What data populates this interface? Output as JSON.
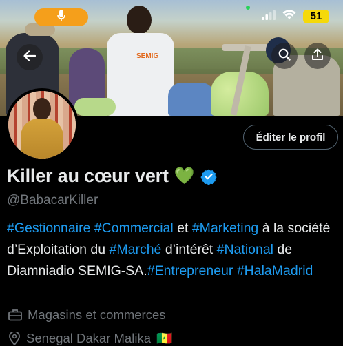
{
  "status_bar": {
    "battery": "51",
    "colors": {
      "pill": "#f59f1b",
      "battery": "#f5d90a"
    },
    "icons": [
      "microphone-icon",
      "signal-icon",
      "wifi-icon",
      "battery-icon"
    ]
  },
  "header": {
    "icons": [
      "back-arrow-icon",
      "search-icon",
      "share-icon"
    ],
    "banner_image_text": "SEMIG"
  },
  "profile": {
    "edit_button": "Éditer le profil",
    "name": "Killer au cœur vert",
    "name_emoji": "💚",
    "verified_icon": "verified-badge-icon",
    "handle": "@BabacarKiller",
    "bio": {
      "t1": "#Gestionnaire",
      "t2": " ",
      "t3": "#Commercial",
      "t4": " et ",
      "t5": "#Marketing",
      "t6": " à la société d’Exploitation du ",
      "t7": "#Marché",
      "t8": " d’intérêt ",
      "t9": "#National",
      "t10": " de Diamniadio SEMIG-SA.",
      "t11": "#Entrepreneur",
      "t12": " ",
      "t13": "#HalaMadrid"
    },
    "category": "Magasins et commerces",
    "location": "Senegal Dakar Malika",
    "location_flag": "🇸🇳"
  },
  "colors": {
    "background": "#000000",
    "link": "#1d9bf0",
    "text": "#e7e9ea",
    "muted": "#71767b",
    "verified": "#1d9bf0",
    "heart": "#2ecc40"
  }
}
